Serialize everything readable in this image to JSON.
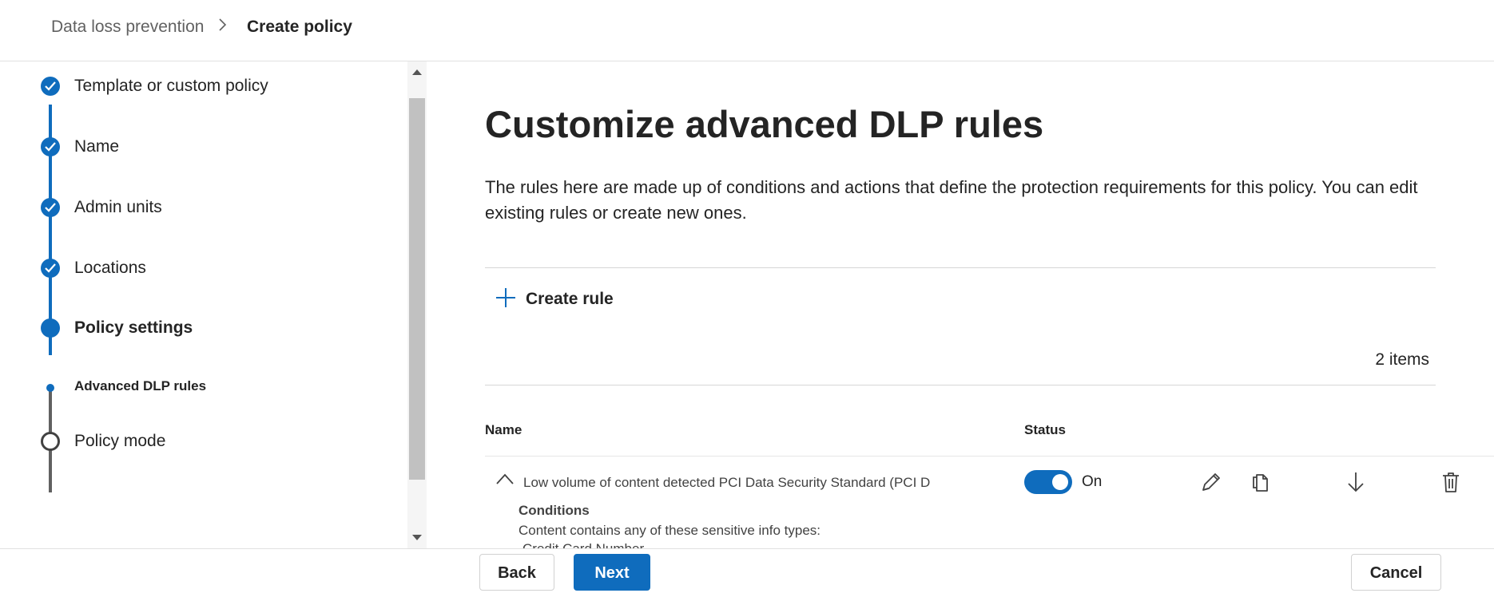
{
  "breadcrumb": {
    "parent": "Data loss prevention",
    "separator": ">",
    "current": "Create policy"
  },
  "stepper": {
    "steps": [
      {
        "label": "Template or custom policy",
        "state": "completed"
      },
      {
        "label": "Name",
        "state": "completed"
      },
      {
        "label": "Admin units",
        "state": "completed"
      },
      {
        "label": "Locations",
        "state": "completed"
      },
      {
        "label": "Policy settings",
        "state": "current"
      },
      {
        "label": "Advanced DLP rules",
        "state": "current-substep"
      },
      {
        "label": "Policy mode",
        "state": "not-started"
      }
    ]
  },
  "main": {
    "title": "Customize advanced DLP rules",
    "description": "The rules here are made up of conditions and actions that define the protection requirements for this policy. You can edit existing rules or create new ones.",
    "create_rule_label": "Create rule",
    "items_count": "2 items",
    "columns": {
      "name": "Name",
      "status": "Status"
    },
    "rules": [
      {
        "name": "Low volume of content detected PCI Data Security Standard (PCI D",
        "status_on": true,
        "status_label": "On",
        "conditions_title": "Conditions",
        "conditions_text": "Content contains any of these sensitive info types:",
        "conditions_item": "Credit Card Number"
      }
    ]
  },
  "footer": {
    "back_label": "Back",
    "next_label": "Next",
    "cancel_label": "Cancel"
  },
  "colors": {
    "accent": "#0f6cbd",
    "text": "#242424"
  }
}
